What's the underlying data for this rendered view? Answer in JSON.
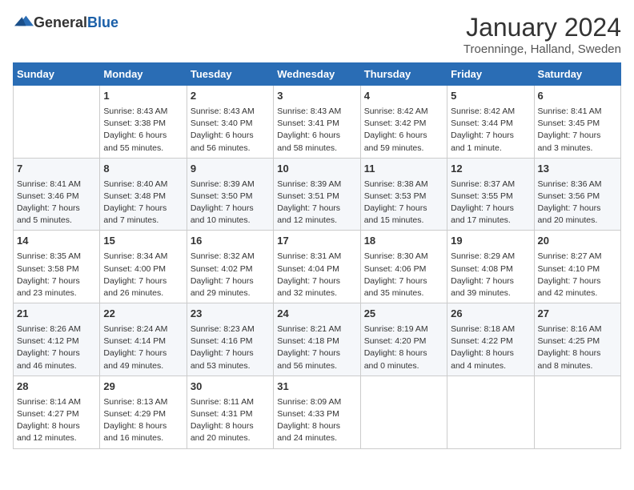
{
  "header": {
    "logo": {
      "general": "General",
      "blue": "Blue"
    },
    "month": "January 2024",
    "location": "Troenninge, Halland, Sweden"
  },
  "calendar": {
    "days_of_week": [
      "Sunday",
      "Monday",
      "Tuesday",
      "Wednesday",
      "Thursday",
      "Friday",
      "Saturday"
    ],
    "weeks": [
      [
        {
          "day": "",
          "info": ""
        },
        {
          "day": "1",
          "info": "Sunrise: 8:43 AM\nSunset: 3:38 PM\nDaylight: 6 hours\nand 55 minutes."
        },
        {
          "day": "2",
          "info": "Sunrise: 8:43 AM\nSunset: 3:40 PM\nDaylight: 6 hours\nand 56 minutes."
        },
        {
          "day": "3",
          "info": "Sunrise: 8:43 AM\nSunset: 3:41 PM\nDaylight: 6 hours\nand 58 minutes."
        },
        {
          "day": "4",
          "info": "Sunrise: 8:42 AM\nSunset: 3:42 PM\nDaylight: 6 hours\nand 59 minutes."
        },
        {
          "day": "5",
          "info": "Sunrise: 8:42 AM\nSunset: 3:44 PM\nDaylight: 7 hours\nand 1 minute."
        },
        {
          "day": "6",
          "info": "Sunrise: 8:41 AM\nSunset: 3:45 PM\nDaylight: 7 hours\nand 3 minutes."
        }
      ],
      [
        {
          "day": "7",
          "info": "Sunrise: 8:41 AM\nSunset: 3:46 PM\nDaylight: 7 hours\nand 5 minutes."
        },
        {
          "day": "8",
          "info": "Sunrise: 8:40 AM\nSunset: 3:48 PM\nDaylight: 7 hours\nand 7 minutes."
        },
        {
          "day": "9",
          "info": "Sunrise: 8:39 AM\nSunset: 3:50 PM\nDaylight: 7 hours\nand 10 minutes."
        },
        {
          "day": "10",
          "info": "Sunrise: 8:39 AM\nSunset: 3:51 PM\nDaylight: 7 hours\nand 12 minutes."
        },
        {
          "day": "11",
          "info": "Sunrise: 8:38 AM\nSunset: 3:53 PM\nDaylight: 7 hours\nand 15 minutes."
        },
        {
          "day": "12",
          "info": "Sunrise: 8:37 AM\nSunset: 3:55 PM\nDaylight: 7 hours\nand 17 minutes."
        },
        {
          "day": "13",
          "info": "Sunrise: 8:36 AM\nSunset: 3:56 PM\nDaylight: 7 hours\nand 20 minutes."
        }
      ],
      [
        {
          "day": "14",
          "info": "Sunrise: 8:35 AM\nSunset: 3:58 PM\nDaylight: 7 hours\nand 23 minutes."
        },
        {
          "day": "15",
          "info": "Sunrise: 8:34 AM\nSunset: 4:00 PM\nDaylight: 7 hours\nand 26 minutes."
        },
        {
          "day": "16",
          "info": "Sunrise: 8:32 AM\nSunset: 4:02 PM\nDaylight: 7 hours\nand 29 minutes."
        },
        {
          "day": "17",
          "info": "Sunrise: 8:31 AM\nSunset: 4:04 PM\nDaylight: 7 hours\nand 32 minutes."
        },
        {
          "day": "18",
          "info": "Sunrise: 8:30 AM\nSunset: 4:06 PM\nDaylight: 7 hours\nand 35 minutes."
        },
        {
          "day": "19",
          "info": "Sunrise: 8:29 AM\nSunset: 4:08 PM\nDaylight: 7 hours\nand 39 minutes."
        },
        {
          "day": "20",
          "info": "Sunrise: 8:27 AM\nSunset: 4:10 PM\nDaylight: 7 hours\nand 42 minutes."
        }
      ],
      [
        {
          "day": "21",
          "info": "Sunrise: 8:26 AM\nSunset: 4:12 PM\nDaylight: 7 hours\nand 46 minutes."
        },
        {
          "day": "22",
          "info": "Sunrise: 8:24 AM\nSunset: 4:14 PM\nDaylight: 7 hours\nand 49 minutes."
        },
        {
          "day": "23",
          "info": "Sunrise: 8:23 AM\nSunset: 4:16 PM\nDaylight: 7 hours\nand 53 minutes."
        },
        {
          "day": "24",
          "info": "Sunrise: 8:21 AM\nSunset: 4:18 PM\nDaylight: 7 hours\nand 56 minutes."
        },
        {
          "day": "25",
          "info": "Sunrise: 8:19 AM\nSunset: 4:20 PM\nDaylight: 8 hours\nand 0 minutes."
        },
        {
          "day": "26",
          "info": "Sunrise: 8:18 AM\nSunset: 4:22 PM\nDaylight: 8 hours\nand 4 minutes."
        },
        {
          "day": "27",
          "info": "Sunrise: 8:16 AM\nSunset: 4:25 PM\nDaylight: 8 hours\nand 8 minutes."
        }
      ],
      [
        {
          "day": "28",
          "info": "Sunrise: 8:14 AM\nSunset: 4:27 PM\nDaylight: 8 hours\nand 12 minutes."
        },
        {
          "day": "29",
          "info": "Sunrise: 8:13 AM\nSunset: 4:29 PM\nDaylight: 8 hours\nand 16 minutes."
        },
        {
          "day": "30",
          "info": "Sunrise: 8:11 AM\nSunset: 4:31 PM\nDaylight: 8 hours\nand 20 minutes."
        },
        {
          "day": "31",
          "info": "Sunrise: 8:09 AM\nSunset: 4:33 PM\nDaylight: 8 hours\nand 24 minutes."
        },
        {
          "day": "",
          "info": ""
        },
        {
          "day": "",
          "info": ""
        },
        {
          "day": "",
          "info": ""
        }
      ]
    ]
  }
}
